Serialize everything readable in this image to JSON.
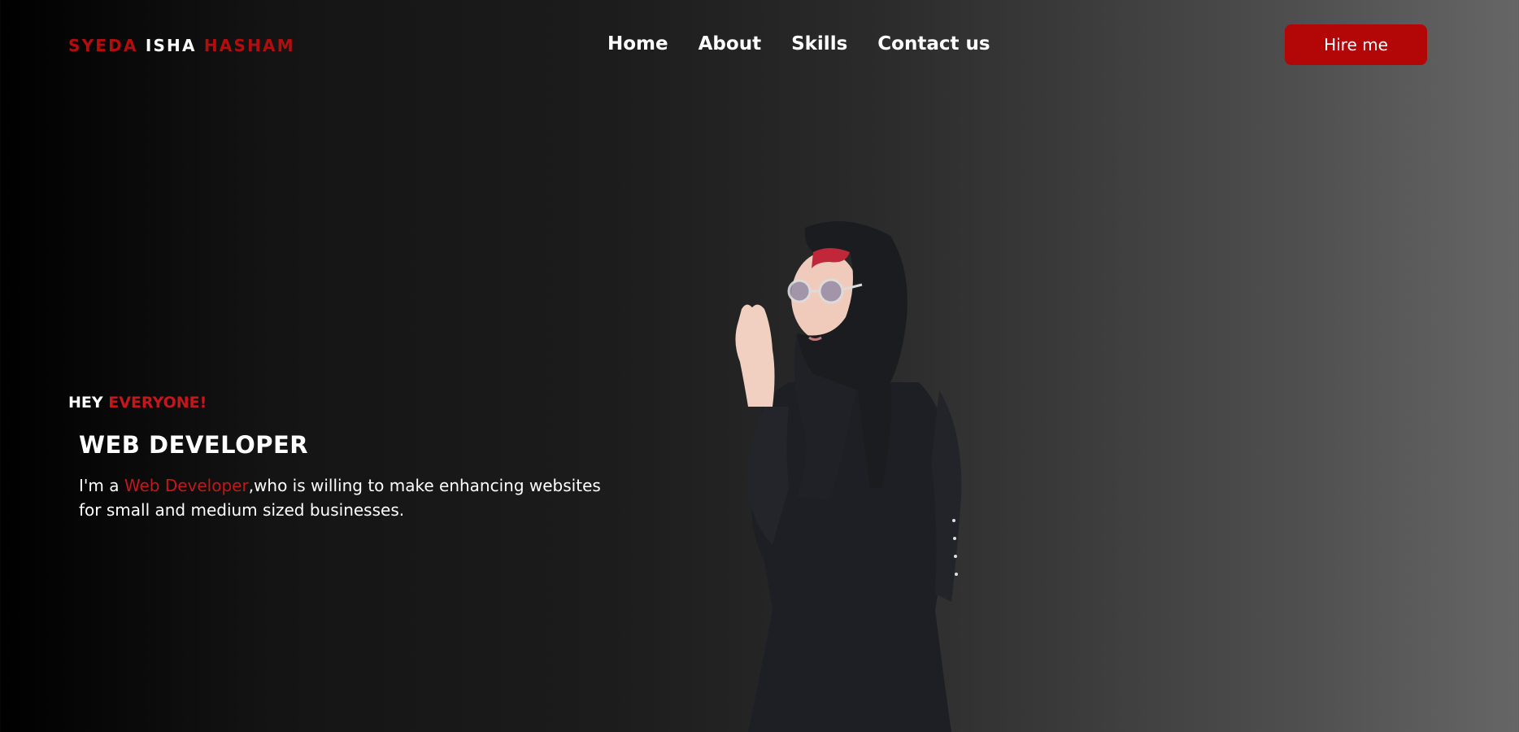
{
  "logo": {
    "part1": "SYEDA",
    "part2": "ISHA",
    "part3": "HASHAM"
  },
  "nav": {
    "items": [
      "Home",
      "About",
      "Skills",
      "Contact us"
    ]
  },
  "hire_button": "Hire me",
  "hero": {
    "greeting_white": "HEY",
    "greeting_red": "EVERYONE!",
    "title": "WEB DEVELOPER",
    "desc_prefix": "I'm a",
    "desc_highlight": "Web Developer",
    "desc_suffix": ",who is willing to make enhancing websites for small and medium sized businesses."
  },
  "colors": {
    "accent": "#b30606",
    "accent_text": "#c4171b",
    "background_dark": "#000000",
    "background_light": "#666666",
    "text": "#ffffff"
  }
}
